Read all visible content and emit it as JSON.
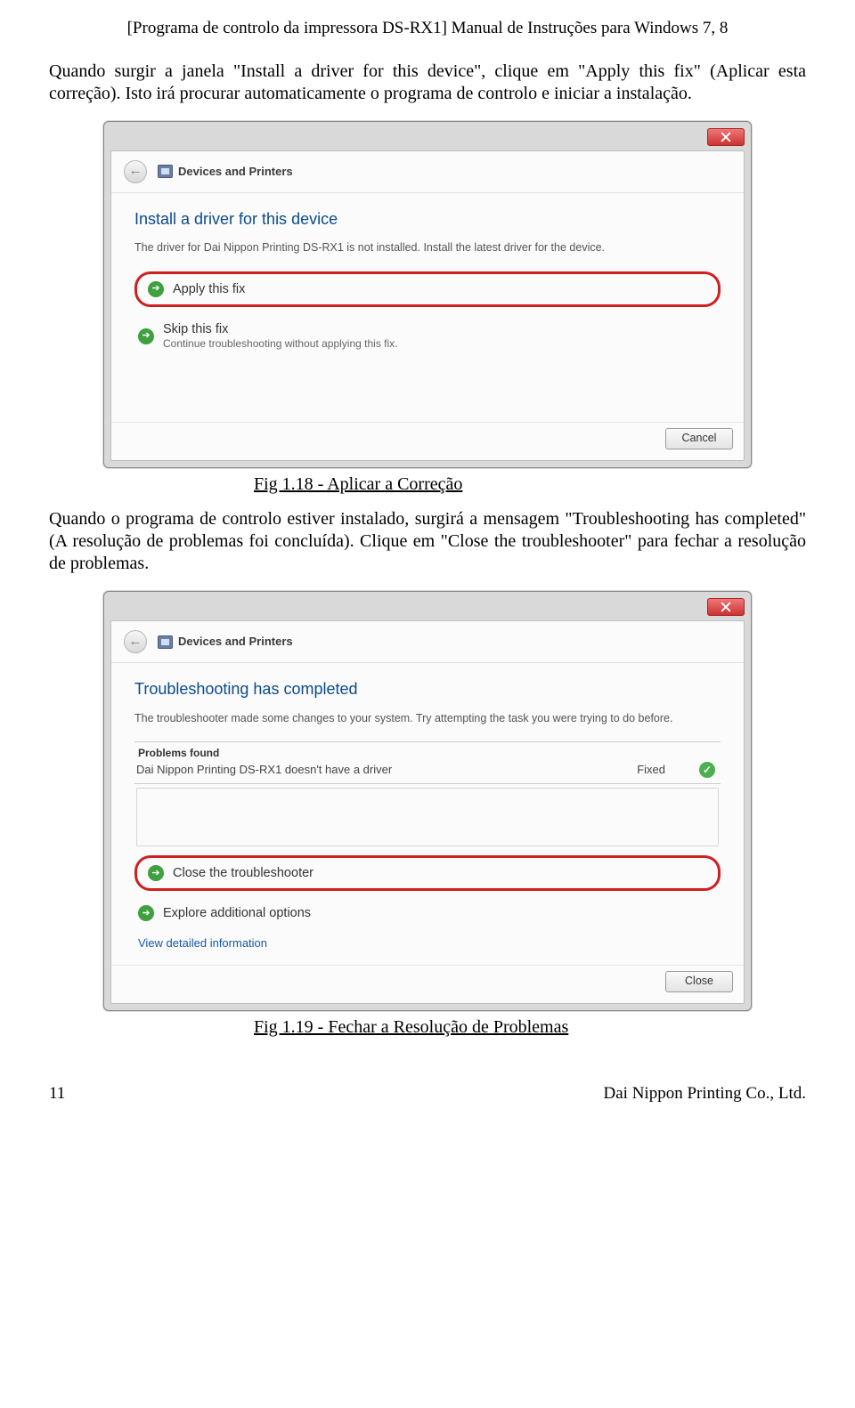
{
  "doc_header": "[Programa de controlo da impressora DS-RX1] Manual de Instruções para Windows 7, 8",
  "para1": "Quando surgir a janela \"Install a driver for this device\", clique em \"Apply this fix\" (Aplicar esta correção). Isto irá procurar automaticamente o programa de controlo e iniciar a instalação.",
  "fig1_caption": "Fig 1.18 - Aplicar a Correção",
  "para2": "Quando o programa de controlo estiver instalado, surgirá a mensagem \"Troubleshooting has completed\" (A resolução de problemas foi concluída). Clique em \"Close the troubleshooter\" para fechar a resolução de problemas.",
  "fig2_caption": "Fig 1.19 - Fechar a Resolução de Problemas",
  "win1": {
    "breadcrumb": "Devices and Printers",
    "heading": "Install a driver for this device",
    "desc": "The driver for Dai Nippon Printing DS-RX1 is not installed. Install the latest driver for the device.",
    "opt_apply": "Apply this fix",
    "opt_skip": "Skip this fix",
    "opt_skip_sub": "Continue troubleshooting without applying this fix.",
    "cancel": "Cancel"
  },
  "win2": {
    "breadcrumb": "Devices and Printers",
    "heading": "Troubleshooting has completed",
    "desc": "The troubleshooter made some changes to your system. Try attempting the task you were trying to do before.",
    "pf_head": "Problems found",
    "pf_item": "Dai Nippon Printing DS-RX1 doesn't have a driver",
    "pf_status": "Fixed",
    "opt_close": "Close the troubleshooter",
    "opt_explore": "Explore additional options",
    "vdi": "View detailed information",
    "close": "Close"
  },
  "page_footer": {
    "num": "11",
    "company": "Dai Nippon Printing Co., Ltd."
  }
}
